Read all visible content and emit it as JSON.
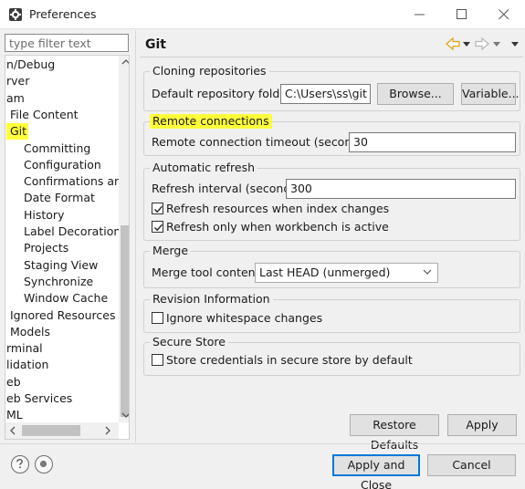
{
  "window": {
    "title": "Preferences"
  },
  "filter": {
    "placeholder": "type filter text"
  },
  "tree": {
    "items": [
      {
        "label": "n/Debug",
        "indent": 0
      },
      {
        "label": "rver",
        "indent": 0
      },
      {
        "label": "am",
        "indent": 0
      },
      {
        "label": " File Content",
        "indent": 0
      },
      {
        "label": " Git",
        "indent": 0,
        "selected": true
      },
      {
        "label": "Committing",
        "indent": 1
      },
      {
        "label": "Configuration",
        "indent": 1
      },
      {
        "label": "Confirmations and",
        "indent": 1
      },
      {
        "label": "Date Format",
        "indent": 1
      },
      {
        "label": "History",
        "indent": 1
      },
      {
        "label": "Label Decorations",
        "indent": 1
      },
      {
        "label": "Projects",
        "indent": 1
      },
      {
        "label": "Staging View",
        "indent": 1
      },
      {
        "label": "Synchronize",
        "indent": 1
      },
      {
        "label": "Window Cache",
        "indent": 1
      },
      {
        "label": " Ignored Resources",
        "indent": 0
      },
      {
        "label": " Models",
        "indent": 0
      },
      {
        "label": "rminal",
        "indent": 0
      },
      {
        "label": "lidation",
        "indent": 0
      },
      {
        "label": "eb",
        "indent": 0
      },
      {
        "label": "eb Services",
        "indent": 0
      },
      {
        "label": "ML",
        "indent": 0
      }
    ]
  },
  "page": {
    "title": "Git"
  },
  "cloning": {
    "legend": "Cloning repositories",
    "folder_label": "Default repository folder:",
    "folder_value": "C:\\Users\\ss\\git",
    "browse_label": "Browse...",
    "variable_label": "Variable..."
  },
  "remote": {
    "legend": "Remote connections",
    "timeout_label": "Remote connection timeout (seconds):",
    "timeout_value": "30"
  },
  "refresh": {
    "legend": "Automatic refresh",
    "interval_label": "Refresh interval (seconds):",
    "interval_value": "300",
    "index_changes_label": "Refresh resources when index changes",
    "index_changes_checked": true,
    "workbench_active_label": "Refresh only when workbench is active",
    "workbench_active_checked": true
  },
  "merge": {
    "legend": "Merge",
    "tool_label": "Merge tool content:",
    "tool_value": "Last HEAD (unmerged)"
  },
  "revision": {
    "legend": "Revision Information",
    "ignore_whitespace_label": "Ignore whitespace changes",
    "ignore_whitespace_checked": false
  },
  "secure": {
    "legend": "Secure Store",
    "store_credentials_label": "Store credentials in secure store by default",
    "store_credentials_checked": false
  },
  "buttons": {
    "restore_defaults": "Restore Defaults",
    "apply": "Apply",
    "apply_and_close": "Apply and Close",
    "cancel": "Cancel"
  },
  "colors": {
    "highlight": "#ffff3c",
    "nav_arrow": "#e3a21a",
    "focus": "#0078d7"
  }
}
